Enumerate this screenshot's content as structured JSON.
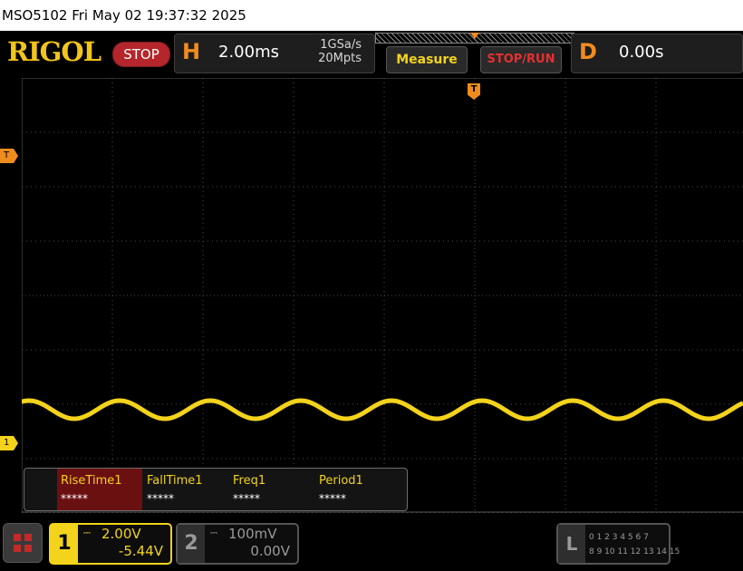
{
  "titlebar": {
    "text": "MSO5102  Fri May 02 19:37:32 2025"
  },
  "toolbar": {
    "logo": "RIGOL",
    "run_state": "STOP",
    "horizontal": {
      "letter": "H",
      "timebase": "2.00ms",
      "sample_rate": "1GSa/s",
      "mem_depth": "20Mpts"
    },
    "measure_label": "Measure",
    "stop_run_label": "STOP/RUN",
    "delay": {
      "letter": "D",
      "value": "0.00s"
    }
  },
  "screen": {
    "trigger_marker_left": "T",
    "trigger_marker_top": "T",
    "ch1_marker": "1",
    "waveform_color": "#f3d31b"
  },
  "measurements": [
    {
      "name": "RiseTime1",
      "value": "*****",
      "selected": true
    },
    {
      "name": "FallTime1",
      "value": "*****",
      "selected": false
    },
    {
      "name": "Freq1",
      "value": "*****",
      "selected": false
    },
    {
      "name": "Period1",
      "value": "*****",
      "selected": false
    }
  ],
  "channels": {
    "ch1": {
      "number": "1",
      "coupling": "⎓",
      "scale": "2.00V",
      "offset": "-5.44V",
      "color": "#f3d31b"
    },
    "ch2": {
      "number": "2",
      "coupling": "⎓",
      "scale": "100mV",
      "offset": "0.00V",
      "color": "#9a9a9a"
    }
  },
  "logic_analyzer": {
    "letter": "L",
    "row1": "0 1 2 3   4 5 6 7",
    "row2": "8 9 10 11  12 13 14 15"
  },
  "colors": {
    "accent_orange": "#f08c1e",
    "brand_yellow": "#f3c41b",
    "stop_red": "#b4262b"
  }
}
